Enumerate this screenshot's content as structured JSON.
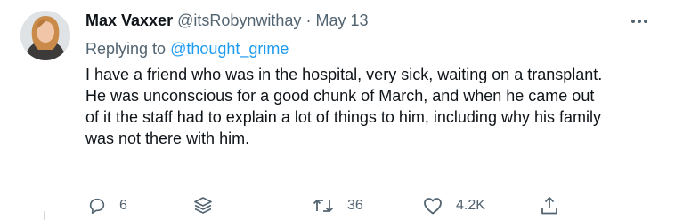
{
  "tweet": {
    "author_name": "Max Vaxxer",
    "handle": "@itsRobynwithay",
    "separator": "·",
    "date": "May 13",
    "replying_prefix": "Replying to",
    "replying_to": "@thought_grime",
    "body_lines": [
      "I have a friend who was in the hospital, very sick, waiting on a transplant.",
      "He was unconscious for a good chunk of March, and when he came out",
      "of it the staff had to explain a lot of things to him, including why his family",
      "was not there with him."
    ]
  },
  "actions": {
    "reply_count": "6",
    "retweet_count": "36",
    "like_count": "4.2K"
  },
  "icons": {
    "more": "more-dots-icon",
    "reply": "reply-bubble-icon",
    "stack": "stack-layers-icon",
    "retweet": "retweet-icon",
    "like": "heart-icon",
    "share": "share-icon"
  },
  "colors": {
    "link": "#1d9bf0",
    "muted": "#536471",
    "text": "#0f1419"
  }
}
